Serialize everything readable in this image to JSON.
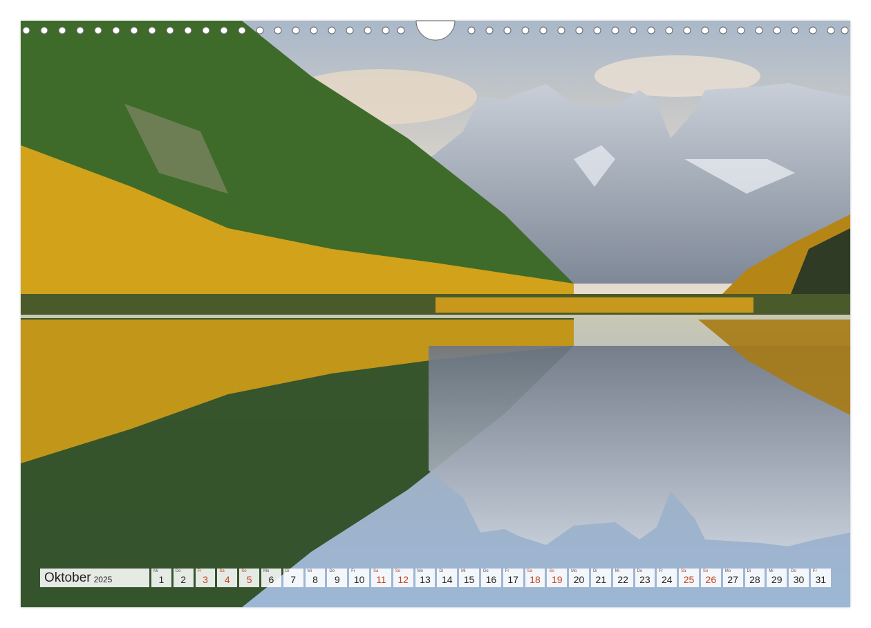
{
  "calendar": {
    "month": "Oktober",
    "year": "2025",
    "days": [
      {
        "n": "1",
        "wd": "Mi",
        "we": false
      },
      {
        "n": "2",
        "wd": "Do",
        "we": false
      },
      {
        "n": "3",
        "wd": "Fr",
        "we": true
      },
      {
        "n": "4",
        "wd": "Sa",
        "we": true
      },
      {
        "n": "5",
        "wd": "So",
        "we": true
      },
      {
        "n": "6",
        "wd": "Mo",
        "we": false
      },
      {
        "n": "7",
        "wd": "Di",
        "we": false
      },
      {
        "n": "8",
        "wd": "Mi",
        "we": false
      },
      {
        "n": "9",
        "wd": "Do",
        "we": false
      },
      {
        "n": "10",
        "wd": "Fr",
        "we": false
      },
      {
        "n": "11",
        "wd": "Sa",
        "we": true
      },
      {
        "n": "12",
        "wd": "So",
        "we": true
      },
      {
        "n": "13",
        "wd": "Mo",
        "we": false
      },
      {
        "n": "14",
        "wd": "Di",
        "we": false
      },
      {
        "n": "15",
        "wd": "Mi",
        "we": false
      },
      {
        "n": "16",
        "wd": "Do",
        "we": false
      },
      {
        "n": "17",
        "wd": "Fr",
        "we": false
      },
      {
        "n": "18",
        "wd": "Sa",
        "we": true
      },
      {
        "n": "19",
        "wd": "So",
        "we": true
      },
      {
        "n": "20",
        "wd": "Mo",
        "we": false
      },
      {
        "n": "21",
        "wd": "Di",
        "we": false
      },
      {
        "n": "22",
        "wd": "Mi",
        "we": false
      },
      {
        "n": "23",
        "wd": "Do",
        "we": false
      },
      {
        "n": "24",
        "wd": "Fr",
        "we": false
      },
      {
        "n": "25",
        "wd": "Sa",
        "we": true
      },
      {
        "n": "26",
        "wd": "So",
        "we": true
      },
      {
        "n": "27",
        "wd": "Mo",
        "we": false
      },
      {
        "n": "28",
        "wd": "Di",
        "we": false
      },
      {
        "n": "29",
        "wd": "Mi",
        "we": false
      },
      {
        "n": "30",
        "wd": "Do",
        "we": false
      },
      {
        "n": "31",
        "wd": "Fr",
        "we": false
      }
    ]
  },
  "colors": {
    "weekend": "#c1431f",
    "text": "#222222"
  }
}
